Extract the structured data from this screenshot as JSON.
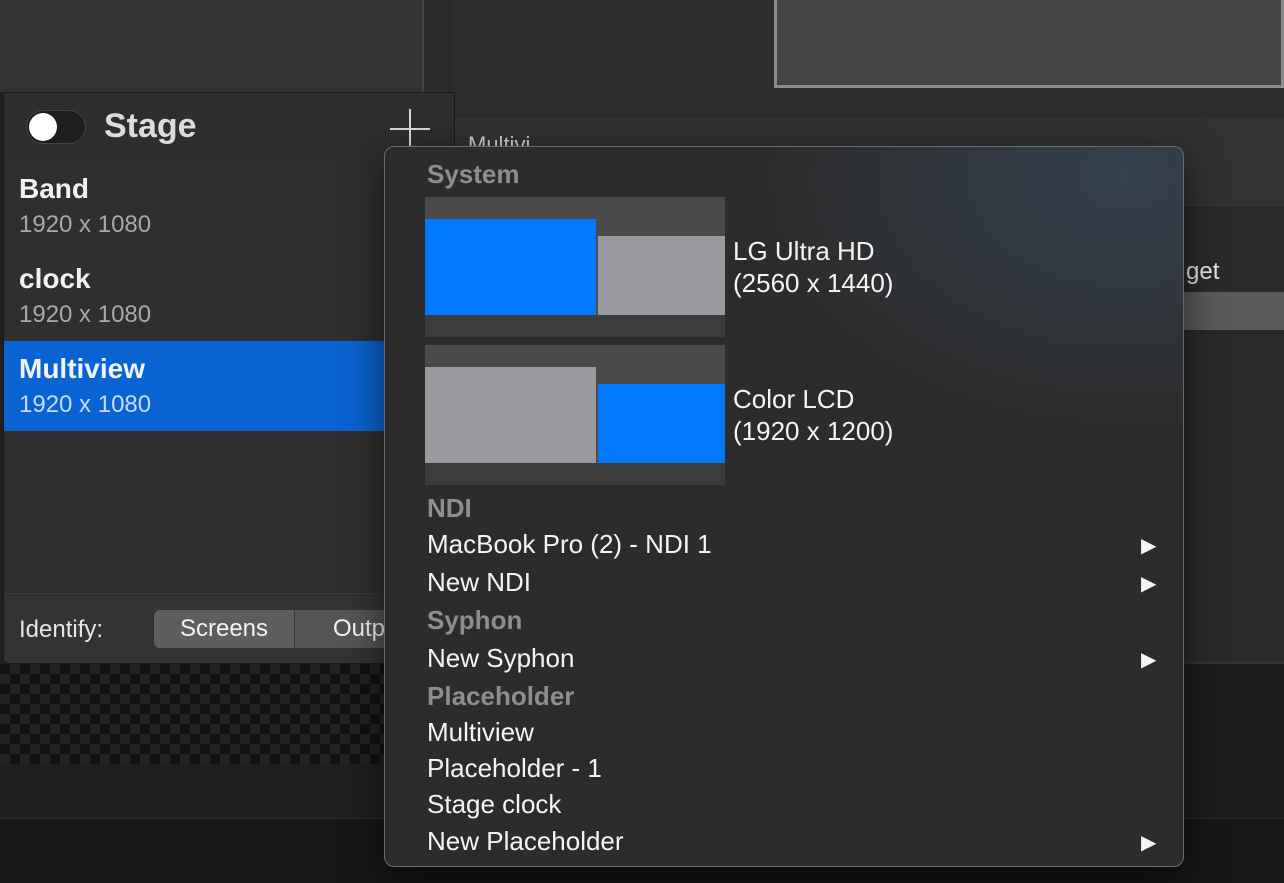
{
  "background": {
    "multiview_heading_fragment": "Multivi",
    "target_label_fragment": "get"
  },
  "stage_panel": {
    "title": "Stage",
    "toggle_on": false,
    "screens": [
      {
        "name": "Band",
        "resolution": "1920 x 1080",
        "selected": false
      },
      {
        "name": "clock",
        "resolution": "1920 x 1080",
        "selected": false
      },
      {
        "name": "Multiview",
        "resolution": "1920 x 1080",
        "selected": true
      }
    ],
    "footer": {
      "identify_label": "Identify:",
      "segments": [
        "Screens",
        "Outputs"
      ]
    }
  },
  "popup_menu": {
    "sections": {
      "system": "System",
      "ndi": "NDI",
      "syphon": "Syphon",
      "placeholder": "Placeholder"
    },
    "displays": [
      {
        "name": "LG Ultra HD",
        "resolution": "(2560 x 1440)",
        "highlighted_monitor": "left"
      },
      {
        "name": "Color LCD",
        "resolution": "(1920 x 1200)",
        "highlighted_monitor": "right"
      }
    ],
    "ndi_items": [
      {
        "label": "MacBook Pro (2) - NDI 1",
        "has_submenu": true
      },
      {
        "label": "New NDI",
        "has_submenu": true
      }
    ],
    "syphon_items": [
      {
        "label": "New Syphon",
        "has_submenu": true
      }
    ],
    "placeholder_items": [
      {
        "label": "Multiview",
        "has_submenu": false
      },
      {
        "label": "Placeholder - 1",
        "has_submenu": false
      },
      {
        "label": "Stage clock",
        "has_submenu": false
      },
      {
        "label": "New Placeholder",
        "has_submenu": true
      }
    ],
    "submenu_arrow": "▶"
  },
  "colors": {
    "selection": "#0a63d2",
    "monitor_active": "#0079ff",
    "monitor_inactive": "#9a9a9e"
  }
}
